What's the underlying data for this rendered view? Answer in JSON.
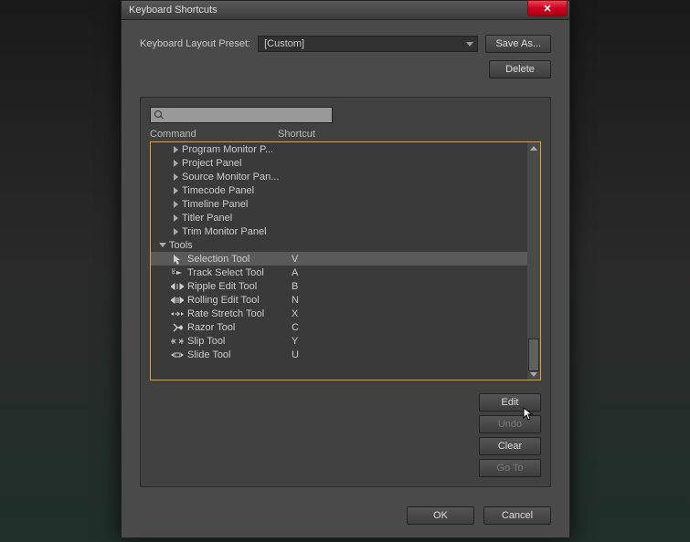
{
  "title": "Keyboard Shortcuts",
  "preset": {
    "label": "Keyboard Layout Preset:",
    "value": "[Custom]",
    "save_as": "Save As...",
    "delete": "Delete"
  },
  "headers": {
    "command": "Command",
    "shortcut": "Shortcut"
  },
  "tree": {
    "panels": [
      "Program Monitor P...",
      "Project Panel",
      "Source Monitor Pan...",
      "Timecode Panel",
      "Timeline Panel",
      "Titler Panel",
      "Trim Monitor Panel"
    ],
    "tools_label": "Tools",
    "tools": [
      {
        "name": "Selection Tool",
        "key": "V",
        "selected": true
      },
      {
        "name": "Track Select Tool",
        "key": "A",
        "selected": false
      },
      {
        "name": "Ripple Edit Tool",
        "key": "B",
        "selected": false
      },
      {
        "name": "Rolling Edit Tool",
        "key": "N",
        "selected": false
      },
      {
        "name": "Rate Stretch Tool",
        "key": "X",
        "selected": false
      },
      {
        "name": "Razor Tool",
        "key": "C",
        "selected": false
      },
      {
        "name": "Slip Tool",
        "key": "Y",
        "selected": false
      },
      {
        "name": "Slide Tool",
        "key": "U",
        "selected": false
      }
    ]
  },
  "actions": {
    "edit": "Edit",
    "undo": "Undo",
    "clear": "Clear",
    "goto": "Go To"
  },
  "footer": {
    "ok": "OK",
    "cancel": "Cancel"
  }
}
